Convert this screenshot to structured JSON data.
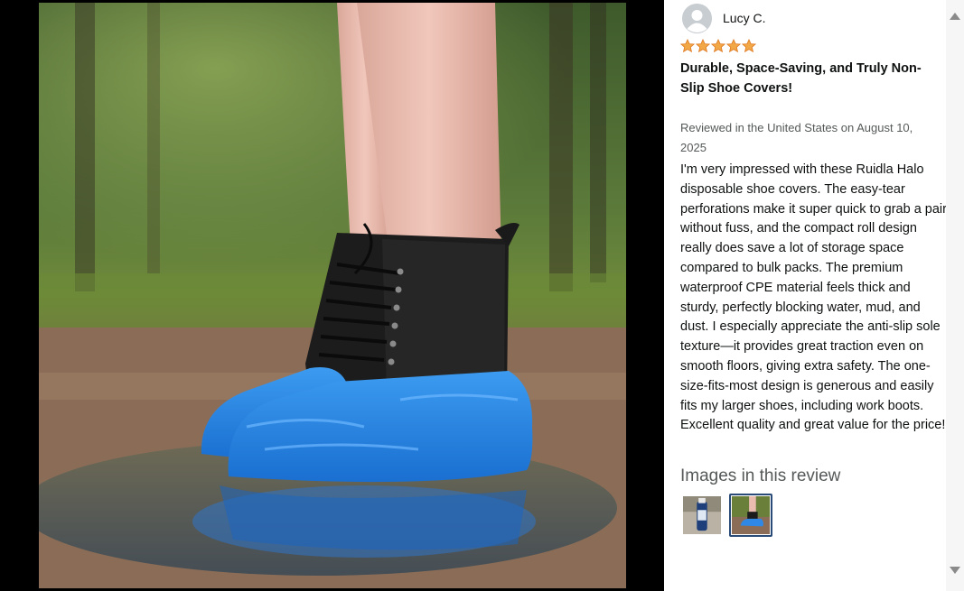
{
  "review": {
    "reviewer_name": "Lucy C.",
    "rating": 5,
    "rating_max": 5,
    "title": "Durable, Space-Saving, and Truly Non-Slip Shoe Covers!",
    "date": "Reviewed in the United States on August 10, 2025",
    "body": "I'm very impressed with these Ruidla Halo disposable shoe covers. The easy-tear perforations make it super quick to grab a pair without fuss, and the compact roll design really does save a lot of storage space compared to bulk packs. The premium waterproof CPE material feels thick and sturdy, perfectly blocking water, mud, and dust. I especially appreciate the anti-slip sole texture—it provides great traction even on smooth floors, giving extra safety. The one-size-fits-most design is generous and easily fits my larger shoes, including work boots. Excellent quality and great value for the price!",
    "images_heading": "Images in this review"
  },
  "icons": {
    "avatar": "user-silhouette-icon",
    "star": "star-icon",
    "scroll_up": "triangle-up-icon",
    "scroll_down": "triangle-down-icon"
  },
  "colors": {
    "star": "#f3a847",
    "star_outline": "#de7921",
    "active_thumb_border": "#2a4b78",
    "secondary_text": "#565959",
    "media_background": "#000000"
  }
}
